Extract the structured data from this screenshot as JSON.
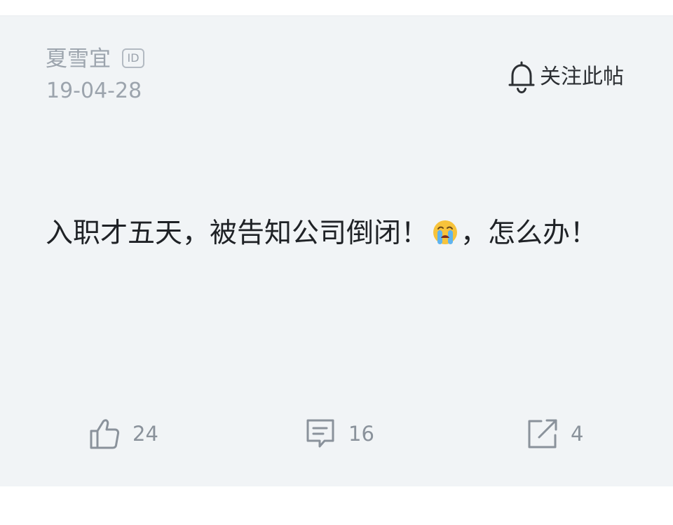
{
  "post": {
    "author": "夏雪宜",
    "id_badge": "ID",
    "date": "19-04-28",
    "follow_label": "关注此帖",
    "content_part1": "入职才五天，被告知公司倒闭！",
    "content_part2": "，怎么办！"
  },
  "actions": {
    "likes": "24",
    "comments": "16",
    "shares": "4"
  },
  "icons": {
    "follow": "bell-icon",
    "like": "thumbs-up-icon",
    "comment": "comment-icon",
    "share": "share-icon",
    "emoji": "loudly-crying-face-emoji"
  },
  "colors": {
    "card_background": "#f1f4f6",
    "meta_text": "#9ca4ad",
    "body_text": "#1f2226",
    "action_icon": "#8a929b"
  }
}
